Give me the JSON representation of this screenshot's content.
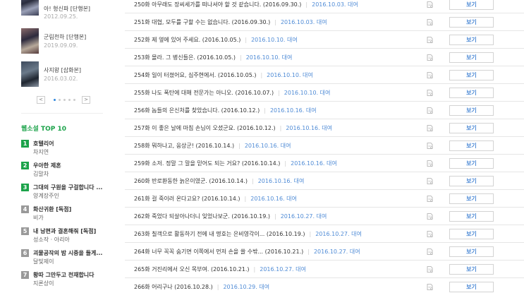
{
  "sidebar": {
    "books": [
      {
        "title": "아! 형신파 [단행본]",
        "date": "2012.09.25."
      },
      {
        "title": "군림천하 [단행본]",
        "date": "2019.09.09."
      },
      {
        "title": "사지왕 [삽화본]",
        "date": "2016.03.02."
      }
    ],
    "pager": {
      "prev": "<",
      "next": ">"
    },
    "ranking_title": "웹소설 TOP 10",
    "ranking": [
      {
        "num": "1",
        "title": "호텔리어",
        "author": "차지연",
        "color": "green"
      },
      {
        "num": "2",
        "title": "우아한 제혼",
        "author": "김말차",
        "color": "green"
      },
      {
        "num": "3",
        "title": "그대의 구원을 구걸합니다 ...",
        "author": "양계장주인",
        "color": "green"
      },
      {
        "num": "4",
        "title": "화산귀환 [독점]",
        "author": "비가",
        "color": "gray"
      },
      {
        "num": "5",
        "title": "내 남편과 결혼해줘 [독점]",
        "author": "성소작 · 아리아",
        "color": "gray"
      },
      {
        "num": "6",
        "title": "괴물공작의 밤 시중을 들게...",
        "author": "달빛제이",
        "color": "gray"
      },
      {
        "num": "7",
        "title": "황따 그만두고 천재합니다",
        "author": "지론상이",
        "color": "gray"
      }
    ]
  },
  "episodes": [
    {
      "title": "250화 아무래도 장씨세가를 떠나셔야 할 것 같습니다.",
      "date": "(2016.09.30.)",
      "free": "2016.10.03. 대여",
      "button": "보기"
    },
    {
      "title": "251화 대협, 모두를 구할 수는 없습니다.",
      "date": "(2016.09.30.)",
      "free": "2016.10.03. 대여",
      "button": "보기"
    },
    {
      "title": "252화 제 옆에 있어 주세요.",
      "date": "(2016.10.05.)",
      "free": "2016.10.10. 대여",
      "button": "보기"
    },
    {
      "title": "253화 몰라. 그 병신들은.",
      "date": "(2016.10.05.)",
      "free": "2016.10.10. 대여",
      "button": "보기"
    },
    {
      "title": "254화 일이 터졌어요, 심주현에서.",
      "date": "(2016.10.05.)",
      "free": "2016.10.10. 대여",
      "button": "보기"
    },
    {
      "title": "255화 나도 폭탄에 대해 전문가는 아니오.",
      "date": "(2016.10.07.)",
      "free": "2016.10.10. 대여",
      "button": "보기"
    },
    {
      "title": "256화 놈들의 은신처를 찾았습니다.",
      "date": "(2016.10.12.)",
      "free": "2016.10.16. 대여",
      "button": "보기"
    },
    {
      "title": "257화 이 좋은 날에 마침 손님이 오셨군요.",
      "date": "(2016.10.12.)",
      "free": "2016.10.16. 대여",
      "button": "보기"
    },
    {
      "title": "258화 뭐하나고, 웅상군!",
      "date": "(2016.10.14.)",
      "free": "2016.10.16. 대여",
      "button": "보기"
    },
    {
      "title": "259화 소저. 정말 그 말을 믿어도 되는 거요?",
      "date": "(2016.10.14.)",
      "free": "2016.10.16. 대여",
      "button": "보기"
    },
    {
      "title": "260화 반로환동한 늙은이였군.",
      "date": "(2016.10.14.)",
      "free": "2016.10.16. 대여",
      "button": "보기"
    },
    {
      "title": "261화 걸 죽이러 온다고요?",
      "date": "(2016.10.14.)",
      "free": "2016.10.16. 대여",
      "button": "보기"
    },
    {
      "title": "262화 죽었다 되살아나더니 잊었나보군.",
      "date": "(2016.10.19.)",
      "free": "2016.10.27. 대여",
      "button": "보기"
    },
    {
      "title": "263화 칠객으로 활동하기 전에 내 명호는 은비영각이...",
      "date": "(2016.10.19.)",
      "free": "2016.10.27. 대여",
      "button": "보기"
    },
    {
      "title": "264화 너무 꼭꼭 숨기면 이쪽에서 먼저 손을 쓸 수밖...",
      "date": "(2016.10.21.)",
      "free": "2016.10.27. 대여",
      "button": "보기"
    },
    {
      "title": "265화 거진리에서 오신 목부여.",
      "date": "(2016.10.21.)",
      "free": "2016.10.27. 대여",
      "button": "보기"
    },
    {
      "title": "266화 어리구나",
      "date": "(2016.10.28.)",
      "free": "2016.10.29. 대여",
      "button": "보기"
    }
  ],
  "colors": {
    "accent_green": "#1ca34a",
    "link_blue": "#4f8bd6",
    "rank_gray": "#999999"
  }
}
